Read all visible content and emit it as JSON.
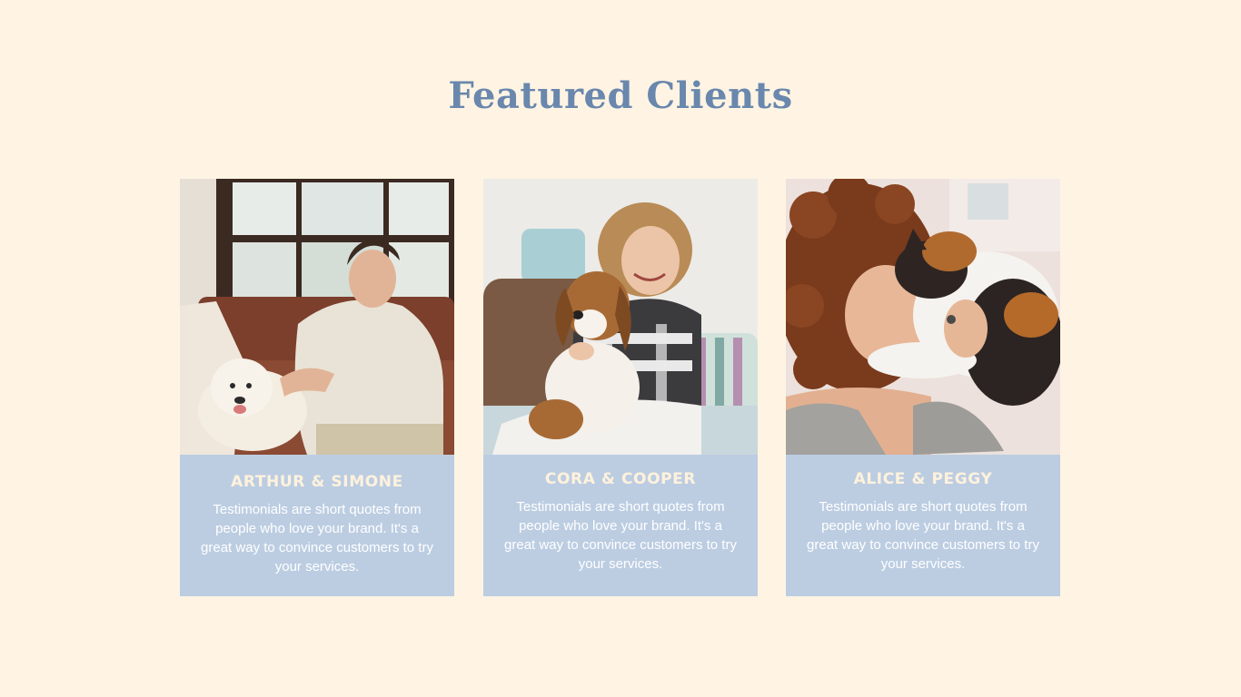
{
  "heading": "Featured Clients",
  "cards": [
    {
      "name": "ARTHUR & SIMONE",
      "quote": "Testimonials are short quotes from people who love your brand. It's a great way to convince customers to try your services.",
      "photo": "man-with-white-dog-on-sofa"
    },
    {
      "name": "CORA & COOPER",
      "quote": "Testimonials are short quotes from people who love your brand. It's a great way to convince customers to try your services.",
      "photo": "woman-hugging-beagle"
    },
    {
      "name": "ALICE & PEGGY",
      "quote": "Testimonials are short quotes from people who love your brand. It's a great way to convince customers to try your services.",
      "photo": "woman-cuddling-calico-cat"
    }
  ],
  "colors": {
    "background": "#fff4e3",
    "heading": "#6a87ad",
    "panel": "#bccde2",
    "name": "#fff2dc",
    "quote": "#ffffff"
  }
}
